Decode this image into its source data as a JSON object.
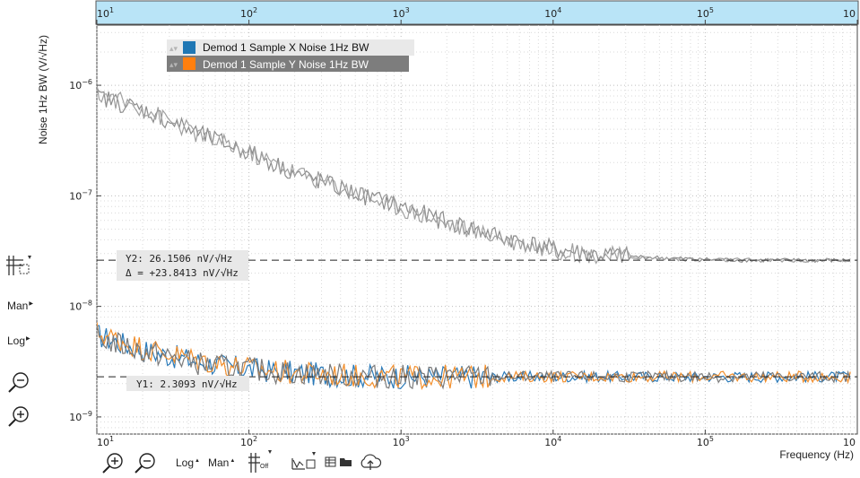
{
  "chart_data": {
    "type": "line",
    "xlabel": "Frequency (Hz)",
    "ylabel": "Noise 1Hz BW (V/√Hz)",
    "xscale": "log",
    "yscale": "log",
    "xlim": [
      10,
      1000000
    ],
    "ylim": [
      7e-10,
      3.5e-06
    ],
    "grid": true,
    "legend_position": "top-left",
    "x_tick_labels": [
      {
        "base": "10",
        "exp": "1"
      },
      {
        "base": "10",
        "exp": "2"
      },
      {
        "base": "10",
        "exp": "3"
      },
      {
        "base": "10",
        "exp": "4"
      },
      {
        "base": "10",
        "exp": "5"
      },
      {
        "base": "10",
        "exp": ""
      }
    ],
    "y_tick_labels": [
      {
        "base": "10",
        "exp": "−6"
      },
      {
        "base": "10",
        "exp": "−7"
      },
      {
        "base": "10",
        "exp": "−8"
      },
      {
        "base": "10",
        "exp": "−9"
      }
    ],
    "series": [
      {
        "name": "Demod 1 Sample X Noise 1Hz BW",
        "color": "#2a7ab9",
        "legend_color": "#1f77b4",
        "x": [
          10,
          20,
          50,
          100,
          200,
          500,
          1000,
          2000,
          5000,
          10000,
          20000,
          50000,
          100000,
          200000,
          500000,
          900000
        ],
        "y": [
          5.5e-09,
          4e-09,
          3.1e-09,
          2.7e-09,
          2.5e-09,
          2.35e-09,
          2.3e-09,
          2.3e-09,
          2.31e-09,
          2.31e-09,
          2.31e-09,
          2.31e-09,
          2.31e-09,
          2.31e-09,
          2.31e-09,
          2.31e-09
        ]
      },
      {
        "name": "Demod 1 Sample Y Noise 1Hz BW",
        "color": "#f28e2b",
        "legend_color": "#ff7f0e",
        "x": [
          10,
          20,
          50,
          100,
          200,
          500,
          1000,
          2000,
          5000,
          10000,
          20000,
          50000,
          100000,
          200000,
          500000,
          900000
        ],
        "y": [
          5.8e-09,
          4.2e-09,
          3.2e-09,
          2.75e-09,
          2.5e-09,
          2.35e-09,
          2.3e-09,
          2.3e-09,
          2.31e-09,
          2.31e-09,
          2.31e-09,
          2.31e-09,
          2.31e-09,
          2.31e-09,
          2.31e-09,
          2.31e-09
        ]
      },
      {
        "name": "",
        "color": "#8c8c8c",
        "x": [
          10,
          20,
          50,
          100,
          200,
          500,
          1000,
          2000,
          5000,
          10000,
          20000,
          50000,
          100000,
          200000,
          500000,
          900000
        ],
        "y": [
          8e-07,
          6e-07,
          3.5e-07,
          2.5e-07,
          1.6e-07,
          1.05e-07,
          8e-08,
          5.8e-08,
          4.1e-08,
          3.3e-08,
          2.9e-08,
          2.75e-08,
          2.65e-08,
          2.62e-08,
          2.6e-08,
          2.6e-08
        ]
      },
      {
        "name": "",
        "color": "#a0a0a0",
        "x": [
          10,
          20,
          50,
          100,
          200,
          500,
          1000,
          2000,
          5000,
          10000,
          20000,
          50000,
          100000,
          200000,
          500000,
          900000
        ],
        "y": [
          8.5e-07,
          6.2e-07,
          3.4e-07,
          2.45e-07,
          1.65e-07,
          1.08e-07,
          7.8e-08,
          5.6e-08,
          4e-08,
          3.25e-08,
          2.9e-08,
          2.72e-08,
          2.64e-08,
          2.61e-08,
          2.6e-08,
          2.6e-08
        ]
      },
      {
        "name": "",
        "color": "#7a7a7a",
        "x": [
          10,
          20,
          50,
          100,
          200,
          500,
          1000,
          2000,
          5000,
          10000,
          20000,
          50000,
          100000,
          200000,
          500000,
          900000
        ],
        "y": [
          5.2e-09,
          3.9e-09,
          3e-09,
          2.7e-09,
          2.5e-09,
          2.35e-09,
          2.3e-09,
          2.3e-09,
          2.31e-09,
          2.31e-09,
          2.31e-09,
          2.31e-09,
          2.31e-09,
          2.31e-09,
          2.31e-09,
          2.31e-09
        ]
      }
    ],
    "cursors": [
      {
        "label": "Y2",
        "value": "26.1506",
        "unit": "nV/√Hz",
        "delta_label": "Δ",
        "delta_value": "+23.8413",
        "delta_unit": "nV/√Hz",
        "y": 2.615e-08
      },
      {
        "label": "Y1",
        "value": "2.3093",
        "unit": "nV/√Hz",
        "y": 2.3093e-09
      }
    ]
  },
  "side_tools": {
    "cursor_icon": "cursor-tool-icon",
    "man_label": "Man",
    "log_label": "Log",
    "zoom_out_icon": "zoom-out-icon",
    "zoom_in_icon": "zoom-in-icon"
  },
  "bottom_tools": {
    "zoom_in_icon": "zoom-in-icon",
    "zoom_out_icon": "zoom-out-icon",
    "log_label": "Log",
    "man_label": "Man",
    "cursor_off_label": "Off",
    "math_icon": "math-tool-icon",
    "table_icon": "table-icon",
    "folder_icon": "folder-icon",
    "cloud_icon": "cloud-upload-icon"
  }
}
